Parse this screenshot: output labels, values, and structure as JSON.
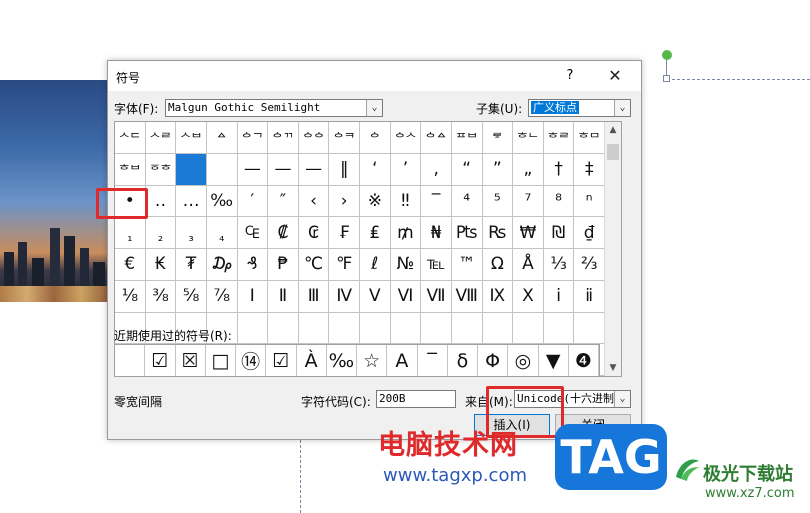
{
  "dialog": {
    "title": "符号",
    "help": "?",
    "close": "✕",
    "font_label": "字体(F):",
    "font_value": "Malgun Gothic Semilight",
    "subset_label": "子集(U):",
    "subset_value": "广义标点",
    "symbols": [
      [
        "ᄉᄃ",
        "ᄉᄅ",
        "ᄉᄇ",
        "ᅀ",
        "ᅌᄀ",
        "ᅌᄁ",
        "ᅌᅌ",
        "ᅌᄏ",
        "ᅌ",
        "ᅌᄉ",
        "ᅌᅀ",
        "ᄑᄇ",
        "ᄛ",
        "ᄒᄂ",
        "ᄒᄅ",
        "ᄒᄆ"
      ],
      [
        "ᄒᄇ",
        "ᅙᄒ",
        "",
        "",
        "—",
        "—",
        "—",
        "‖",
        "‘",
        "’",
        "‚",
        "“",
        "”",
        "„",
        "†",
        "‡"
      ],
      [
        "•",
        "‥",
        "…",
        "‰",
        "′",
        "″",
        "‹",
        "›",
        "※",
        "‼",
        "‾",
        "⁴",
        "⁵",
        "⁷",
        "⁸",
        "ⁿ"
      ],
      [
        "₁",
        "₂",
        "₃",
        "₄",
        "₠",
        "₡",
        "₢",
        "₣",
        "₤",
        "₥",
        "₦",
        "₧",
        "₨",
        "₩",
        "₪",
        "₫"
      ],
      [
        "€",
        "₭",
        "₮",
        "₯",
        "₰",
        "₱",
        "℃",
        "℉",
        "ℓ",
        "№",
        "℡",
        "™",
        "Ω",
        "Å",
        "⅓",
        "⅔"
      ],
      [
        "⅛",
        "⅜",
        "⅝",
        "⅞",
        "Ⅰ",
        "Ⅱ",
        "Ⅲ",
        "Ⅳ",
        "Ⅴ",
        "Ⅵ",
        "Ⅶ",
        "Ⅷ",
        "Ⅸ",
        "Ⅹ",
        "ⅰ",
        "ⅱ"
      ]
    ],
    "recent_label": "近期使用过的符号(R):",
    "recent_symbols": [
      "",
      "☑",
      "☒",
      "□",
      "⑭",
      "☑",
      "À",
      "‰",
      "☆",
      "A",
      "‾",
      "δ",
      "Φ",
      "◎",
      "▼",
      "❹"
    ],
    "char_name": "零宽间隔",
    "char_code_label": "字符代码(C):",
    "char_code_value": "200B",
    "from_label": "来自(M):",
    "from_value": "Unicode(十六进制)",
    "insert_button": "插入(I)",
    "cancel_button": "关闭"
  },
  "watermark": {
    "brand_cn": "电脑技术网",
    "brand_url": "www.tagxp.com",
    "tag": "TAG",
    "xz_cn": "极光下载站",
    "xz_url": "www.xz7.com"
  },
  "colors": {
    "selection_blue": "#1a7ad6",
    "highlight_red": "#e0292b",
    "watermark_blue": "#2c59b8",
    "tag_blue": "#1676d9",
    "xz_green": "#2e7d32"
  }
}
